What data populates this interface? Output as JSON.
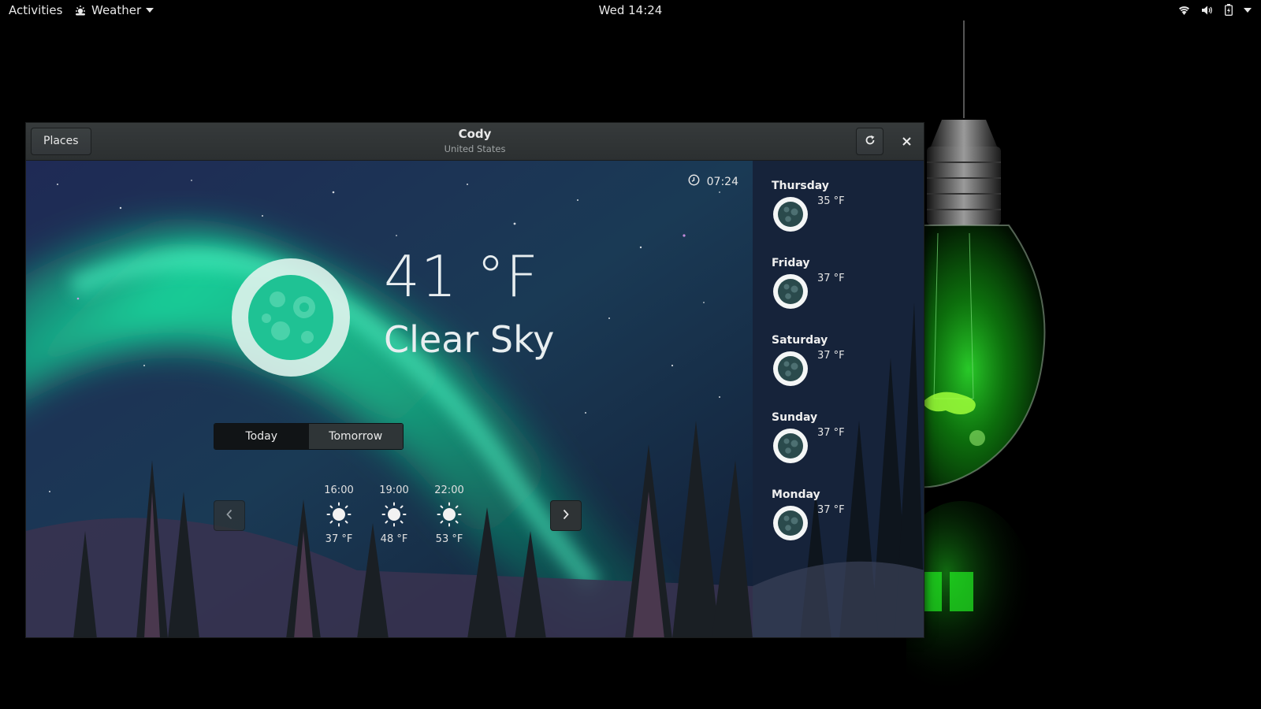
{
  "topbar": {
    "activities": "Activities",
    "app_name": "Weather",
    "clock": "Wed 14:24"
  },
  "window": {
    "places_label": "Places",
    "title": "Cody",
    "subtitle": "United States"
  },
  "current": {
    "updated_time": "07:24",
    "temperature": "41 °F",
    "condition": "Clear Sky"
  },
  "day_tabs": {
    "today": "Today",
    "tomorrow": "Tomorrow",
    "selected": "today"
  },
  "hourly": [
    {
      "time": "16:00",
      "temp": "37 °F",
      "icon": "sun-icon"
    },
    {
      "time": "19:00",
      "temp": "48 °F",
      "icon": "sun-icon"
    },
    {
      "time": "22:00",
      "temp": "53 °F",
      "icon": "sun-icon"
    }
  ],
  "forecast": [
    {
      "day": "Thursday",
      "temp": "35 °F",
      "icon": "moon-icon"
    },
    {
      "day": "Friday",
      "temp": "37 °F",
      "icon": "moon-icon"
    },
    {
      "day": "Saturday",
      "temp": "37 °F",
      "icon": "moon-icon"
    },
    {
      "day": "Sunday",
      "temp": "37 °F",
      "icon": "moon-icon"
    },
    {
      "day": "Monday",
      "temp": "37 °F",
      "icon": "moon-icon"
    }
  ],
  "colors": {
    "aurora": "#19e0a0",
    "sky": "#1b2a4a",
    "headerbar": "#33373a",
    "bulb_glow": "#2bd42b"
  }
}
